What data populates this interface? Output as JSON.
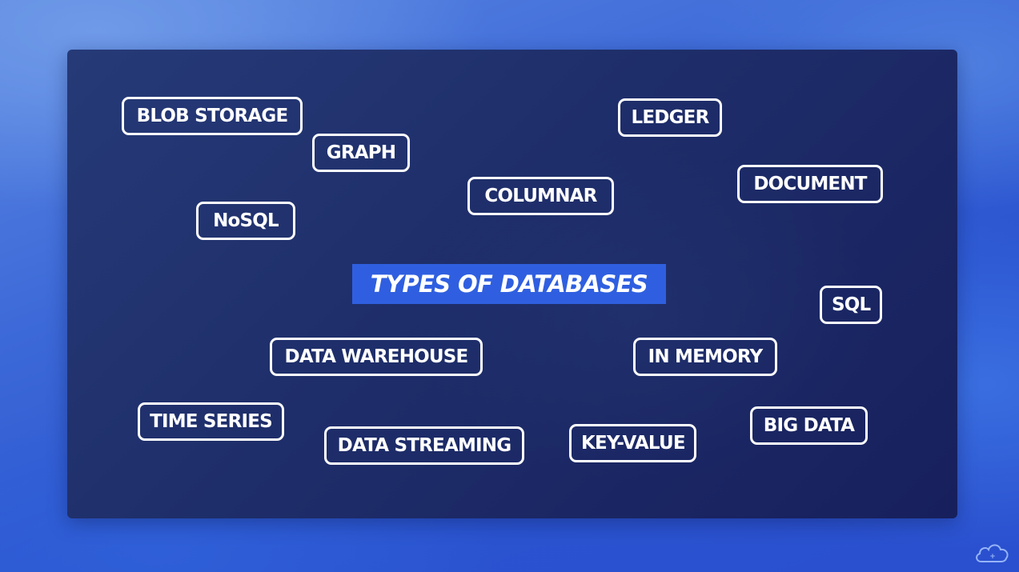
{
  "title": "TYPES OF DATABASES",
  "tags": {
    "blob_storage": "BLOB STORAGE",
    "graph": "GRAPH",
    "ledger": "LEDGER",
    "columnar": "COLUMNAR",
    "document": "DOCUMENT",
    "nosql": "NoSQL",
    "sql": "SQL",
    "data_warehouse": "DATA WAREHOUSE",
    "in_memory": "IN MEMORY",
    "time_series": "TIME SERIES",
    "data_streaming": "DATA STREAMING",
    "key_value": "KEY-VALUE",
    "big_data": "BIG DATA"
  },
  "icons": {
    "logo": "cloud-logo-icon"
  }
}
